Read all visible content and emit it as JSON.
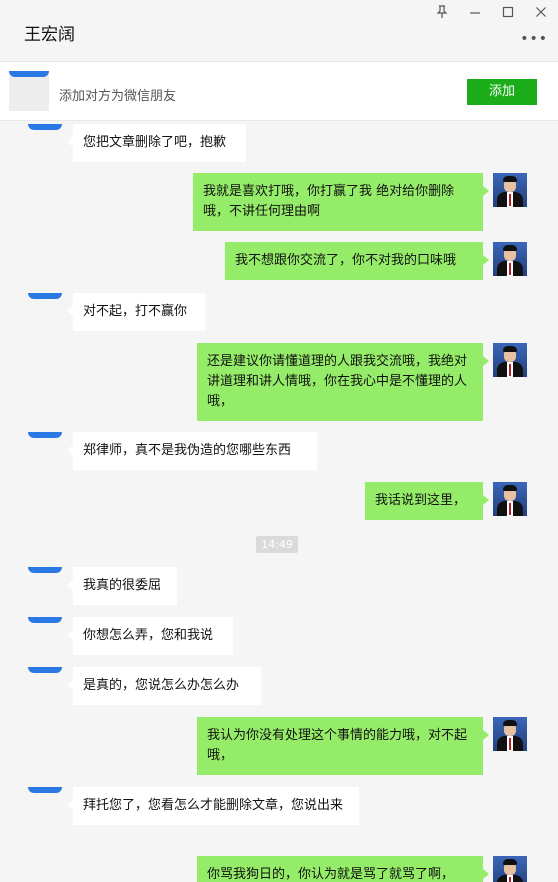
{
  "header": {
    "title": "王宏阔",
    "more_icon": "more-dots-icon",
    "controls": [
      "pin-icon",
      "minimize-icon",
      "maximize-icon",
      "close-icon"
    ]
  },
  "add_friend": {
    "text": "添加对方为微信朋友",
    "button_label": "添加"
  },
  "colors": {
    "accent_green": "#1aad19",
    "bubble_green": "#95ec69",
    "bubble_white": "#ffffff"
  },
  "messages": [
    {
      "side": "left",
      "text": "您把文章删除了吧，抱歉"
    },
    {
      "side": "right",
      "text": "我就是喜欢打哦，你打赢了我 绝对给你删除哦，不讲任何理由啊"
    },
    {
      "side": "right",
      "text": "我不想跟你交流了，你不对我的口味哦"
    },
    {
      "side": "left",
      "text": "对不起，打不赢你"
    },
    {
      "side": "right",
      "text": "还是建议你请懂道理的人跟我交流哦，我绝对讲道理和讲人情哦，你在我心中是不懂理的人哦，"
    },
    {
      "side": "left",
      "text": "郑律师，真不是我伪造的您哪些东西"
    },
    {
      "side": "right",
      "text": "我话说到这里，"
    },
    {
      "side": "left",
      "text": "我真的很委屈"
    },
    {
      "side": "left",
      "text": "你想怎么弄，您和我说"
    },
    {
      "side": "left",
      "text": "是真的，您说怎么办怎么办"
    },
    {
      "side": "right",
      "text": "我认为你没有处理这个事情的能力哦，对不起哦，"
    },
    {
      "side": "left",
      "text": "拜托您了，您看怎么才能删除文章，您说出来"
    },
    {
      "side": "right",
      "text": "你骂我狗日的，你认为就是骂了就骂了啊，"
    }
  ],
  "timestamp": "14:49"
}
